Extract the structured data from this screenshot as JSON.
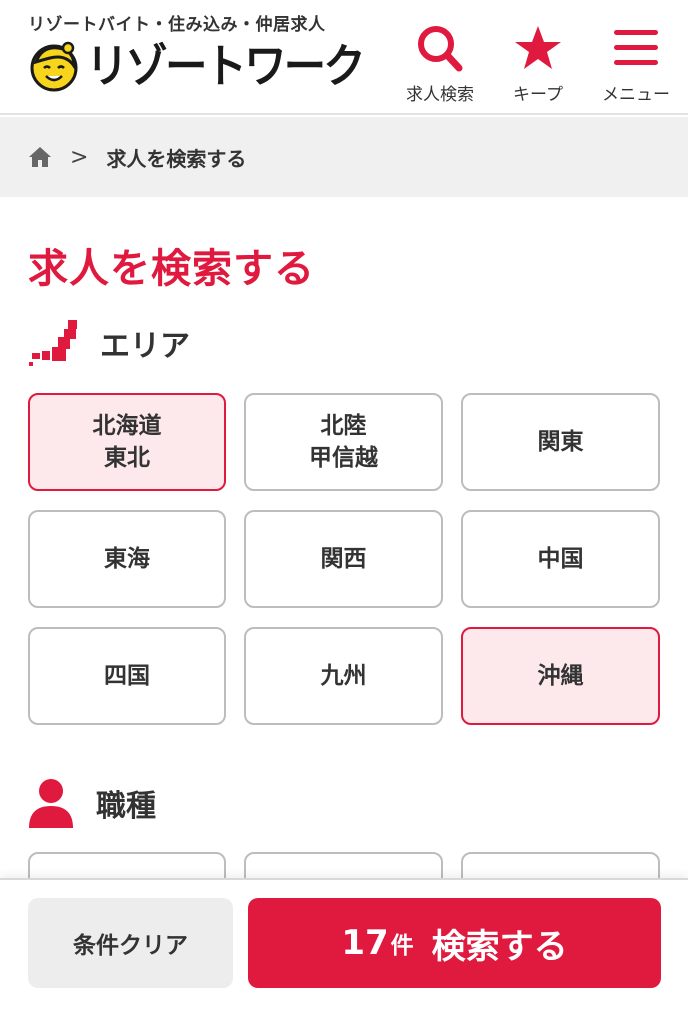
{
  "colors": {
    "accent": "#e0193e",
    "selected_bg": "#fde8ec",
    "breadcrumb_bg": "#f0f0f0",
    "logo_yellow": "#f7d51d"
  },
  "header": {
    "tagline": "リゾートバイト・住み込み・仲居求人",
    "logo_text": "リゾートワーク",
    "nav": [
      {
        "icon": "search-icon",
        "label": "求人検索"
      },
      {
        "icon": "star-icon",
        "label": "キープ"
      },
      {
        "icon": "hamburger-menu-icon",
        "label": "メニュー"
      }
    ]
  },
  "breadcrumb": {
    "home_icon": "home-icon",
    "separator": ">",
    "current": "求人を検索する"
  },
  "page_title": "求人を検索する",
  "sections": {
    "area": {
      "icon": "japan-map-icon",
      "title": "エリア",
      "options": [
        {
          "label": "北海道\n東北",
          "selected": true
        },
        {
          "label": "北陸\n甲信越",
          "selected": false
        },
        {
          "label": "関東",
          "selected": false
        },
        {
          "label": "東海",
          "selected": false
        },
        {
          "label": "関西",
          "selected": false
        },
        {
          "label": "中国",
          "selected": false
        },
        {
          "label": "四国",
          "selected": false
        },
        {
          "label": "九州",
          "selected": false
        },
        {
          "label": "沖縄",
          "selected": true
        }
      ]
    },
    "job": {
      "icon": "person-icon",
      "title": "職種"
    }
  },
  "footer": {
    "clear_label": "条件クリア",
    "count": "17",
    "count_unit": "件",
    "search_label": "検索する"
  }
}
